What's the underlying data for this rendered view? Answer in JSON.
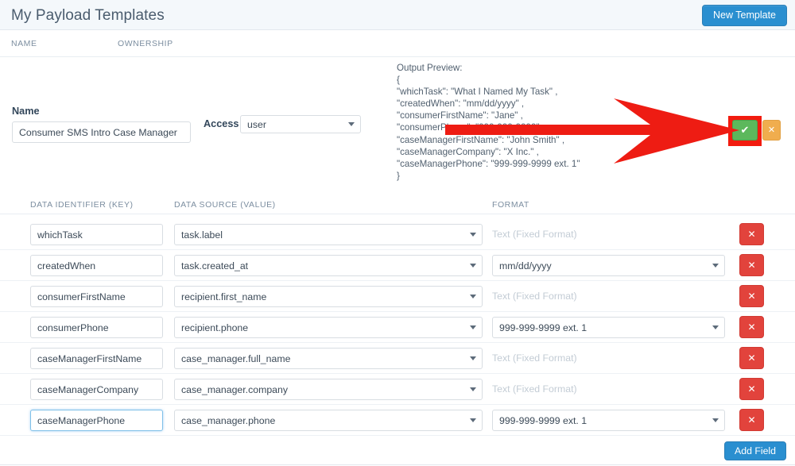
{
  "header": {
    "title": "My Payload Templates",
    "new_template_label": "New Template"
  },
  "list_header": {
    "name_label": "NAME",
    "ownership_label": "OWNERSHIP"
  },
  "output_preview": {
    "label": "Output Preview:",
    "text": "Output Preview:\n{\n\"whichTask\": \"What I Named My Task\" ,\n\"createdWhen\": \"mm/dd/yyyy\" ,\n\"consumerFirstName\": \"Jane\" ,\n\"consumerPhone\": \"999-999-9999\" ,\n\"caseManagerFirstName\": \"John Smith\" ,\n\"caseManagerCompany\": \"X Inc.\" ,\n\"caseManagerPhone\": \"999-999-9999 ext. 1\"\n}"
  },
  "form": {
    "name_label": "Name",
    "name_value": "Consumer SMS Intro Case Manager",
    "access_label": "Access",
    "access_value": "user",
    "access_options": [
      "user"
    ],
    "save_glyph": "✔",
    "cancel_glyph": "✕"
  },
  "fields_header": {
    "key": "DATA IDENTIFIER (KEY)",
    "source": "DATA SOURCE (VALUE)",
    "format": "FORMAT"
  },
  "fields": [
    {
      "key": "whichTask",
      "source": "task.label",
      "format_type": "static",
      "format": "Text (Fixed Format)",
      "focused": false
    },
    {
      "key": "createdWhen",
      "source": "task.created_at",
      "format_type": "select",
      "format": "mm/dd/yyyy",
      "focused": false
    },
    {
      "key": "consumerFirstName",
      "source": "recipient.first_name",
      "format_type": "static",
      "format": "Text (Fixed Format)",
      "focused": false
    },
    {
      "key": "consumerPhone",
      "source": "recipient.phone",
      "format_type": "select",
      "format": "999-999-9999 ext. 1",
      "focused": false
    },
    {
      "key": "caseManagerFirstName",
      "source": "case_manager.full_name",
      "format_type": "static",
      "format": "Text (Fixed Format)",
      "focused": false
    },
    {
      "key": "caseManagerCompany",
      "source": "case_manager.company",
      "format_type": "static",
      "format": "Text (Fixed Format)",
      "focused": false
    },
    {
      "key": "caseManagerPhone",
      "source": "case_manager.phone",
      "format_type": "select",
      "format": "999-999-9999 ext. 1",
      "focused": true
    }
  ],
  "row_delete_glyph": "✕",
  "footer": {
    "add_field_label": "Add Field"
  },
  "annotation": {
    "arrow_color": "#ee1c13",
    "highlight_color": "#f21b0f"
  },
  "colors": {
    "primary_button": "#2a8fd0",
    "save_button": "#5cb85c",
    "cancel_button": "#f0ad4e",
    "delete_button": "#e2433c"
  }
}
